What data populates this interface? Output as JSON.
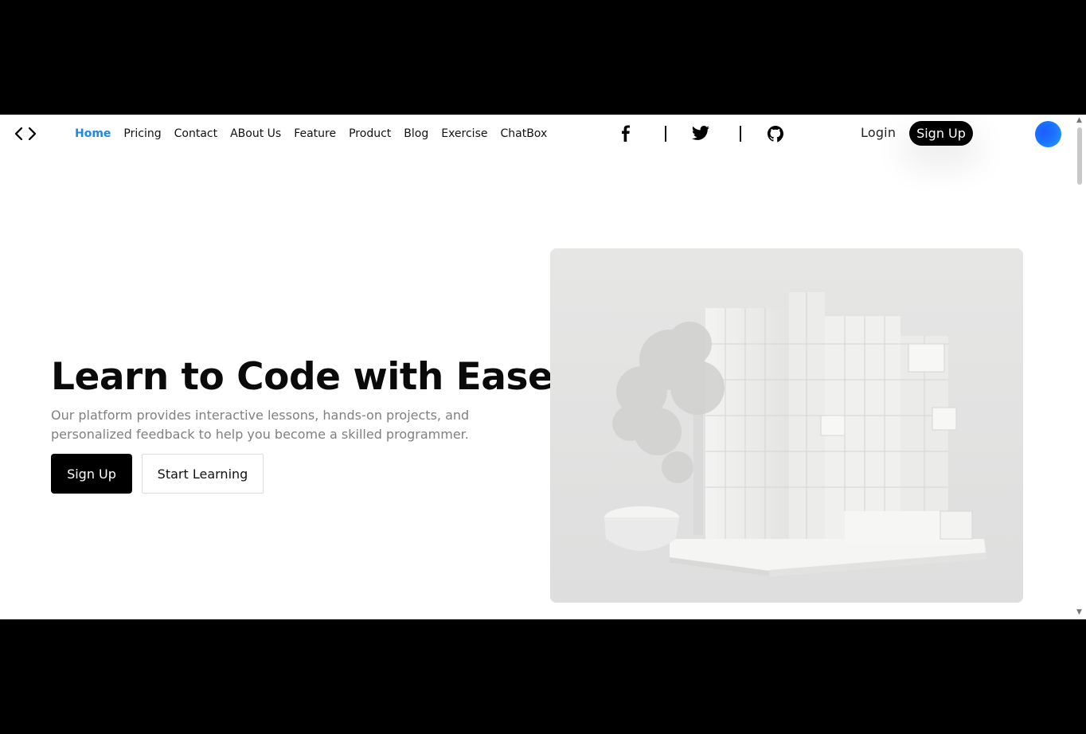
{
  "nav": {
    "logo_icon": "code-brackets-icon",
    "links": [
      {
        "label": "Home",
        "active": true
      },
      {
        "label": "Pricing",
        "active": false
      },
      {
        "label": "Contact",
        "active": false
      },
      {
        "label": "ABout Us",
        "active": false
      },
      {
        "label": "Feature",
        "active": false
      },
      {
        "label": "Product",
        "active": false
      },
      {
        "label": "Blog",
        "active": false
      },
      {
        "label": "Exercise",
        "active": false
      },
      {
        "label": "ChatBox",
        "active": false
      }
    ],
    "social_icons": [
      "facebook-icon",
      "twitter-icon",
      "github-icon"
    ],
    "login_label": "Login",
    "signup_label": "Sign Up",
    "active_color": "#1e88e5"
  },
  "hero": {
    "title": "Learn to Code with Ease",
    "description": "Our platform provides interactive lessons, hands-on projects, and personalized feedback to help you become a skilled programmer.",
    "primary_button": "Sign Up",
    "secondary_button": "Start Learning",
    "image": "white-cube-structure-with-tree-render"
  }
}
